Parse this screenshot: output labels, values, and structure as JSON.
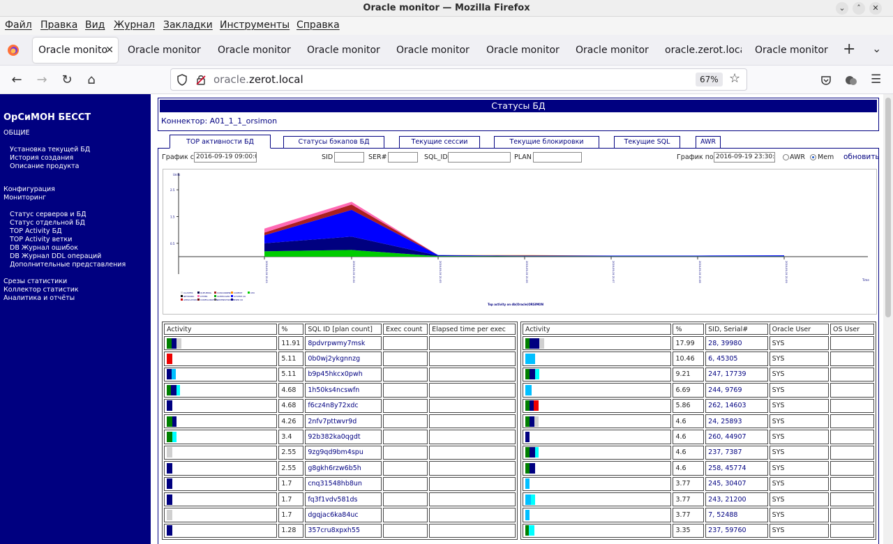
{
  "window": {
    "title": "Oracle monitor — Mozilla Firefox"
  },
  "menu": [
    "Файл",
    "Правка",
    "Вид",
    "Журнал",
    "Закладки",
    "Инструменты",
    "Справка"
  ],
  "tabs": [
    {
      "label": "Oracle monito",
      "active": true
    },
    {
      "label": "Oracle monitor"
    },
    {
      "label": "Oracle monitor"
    },
    {
      "label": "Oracle monitor"
    },
    {
      "label": "Oracle monitor"
    },
    {
      "label": "Oracle monitor"
    },
    {
      "label": "Oracle monitor"
    },
    {
      "label": "oracle.zerot.loca"
    },
    {
      "label": "Oracle monitor"
    }
  ],
  "urlbar": {
    "host_prefix": "oracle.",
    "host": "zerot.local",
    "zoom": "67%"
  },
  "sidebar": {
    "brand": "ОрСиМОН БЕССТ",
    "section_general": "ОБЩИЕ",
    "general_items": [
      "Установка текущей БД",
      "История создания",
      "Описание продукта"
    ],
    "config": "Конфигурация",
    "monitoring": "Мониторинг",
    "monitoring_items": [
      "Статус серверов и БД",
      "Статус отдельной БД",
      "TOP Activity БД",
      "TOP Activity ветки",
      "DB Журнал ошибок",
      "DB Журнал DDL операций",
      "Дополнительные представления"
    ],
    "bottom_items": [
      "Срезы статистики",
      "Коллектор статистик",
      "Аналитика и отчёты"
    ]
  },
  "page": {
    "status_title": "Статусы БД",
    "connector": "Коннектор: A01_1_1_orsimon",
    "tabs": [
      "TOP активности БД",
      "Статусы бэкапов БД",
      "Текущие сессии",
      "Текущие блокировки",
      "Текущие SQL",
      "AWR"
    ],
    "filters": {
      "from_label": "График с",
      "from_value": "2016-09-19 09:00:0",
      "sid_label": "SID",
      "ser_label": "SER#",
      "sqlid_label": "SQL_ID",
      "plan_label": "PLAN",
      "to_label": "График по",
      "to_value": "2016-09-19 23:30:0",
      "awr_label": "AWR",
      "mem_label": "Mem",
      "refresh": "обновить"
    }
  },
  "chart_data": {
    "type": "area",
    "title": "Top activity on db(Oracle)ORSIMON",
    "ylabel": "Units",
    "xlabel": "Time",
    "ylim": [
      0,
      3
    ],
    "yticks": [
      0.5,
      1.5,
      2.5
    ],
    "x": [
      "2016-09-19 21:03",
      "2016-09-19 21:04",
      "2016-09-19 21:05",
      "2016-09-19 21:06",
      "2016-09-19 21:07",
      "2016-09-19 21:08",
      "2016-09-19 21:09"
    ],
    "series": [
      {
        "name": "CPU",
        "color": "#00cc00",
        "values": [
          0.2,
          0.25,
          0.02,
          0.01,
          0.01,
          0.01,
          0.01
        ]
      },
      {
        "name": "USER I/O",
        "color": "#000080",
        "values": [
          0.3,
          0.5,
          0.02,
          0.01,
          0.01,
          0.01,
          0.01
        ]
      },
      {
        "name": "SYSTEM I/O",
        "color": "#0000ff",
        "values": [
          0.3,
          1.0,
          0.02,
          0.02,
          0.02,
          0.02,
          0.03
        ]
      },
      {
        "name": "CONCURRENCY",
        "color": "#aa2020",
        "values": [
          0.1,
          0.2,
          0.0,
          0.0,
          0.0,
          0.0,
          0.0
        ]
      },
      {
        "name": "OTHER",
        "color": "#ff69b4",
        "values": [
          0.15,
          0.1,
          0.0,
          0.0,
          0.0,
          0.0,
          0.0
        ]
      },
      {
        "name": "COMMIT",
        "color": "#ff8c00",
        "values": [
          0.0,
          0.0,
          0.0,
          0.02,
          0.0,
          0.0,
          0.0
        ]
      }
    ],
    "legend": [
      "CLUSTER",
      "NETWORK",
      "APPLICATION",
      "QUEUEING",
      "OTHER",
      "CONFIGURATION",
      "CONCURRENCY",
      "SCHEDULER",
      "ADMINISTRATIVE",
      "COMMIT",
      "SYSTEM I/O",
      "USER I/O",
      "CPU"
    ]
  },
  "sql_table": {
    "headers": [
      "Activity",
      "%",
      "SQL ID [plan count]",
      "Exec count",
      "Elapsed time per exec"
    ],
    "rows": [
      {
        "pct": "11.91",
        "id": "8pdvrpwmy7msk",
        "bars": [
          [
            "#008000",
            7
          ],
          [
            "#000080",
            7
          ],
          [
            "#d0d0d0",
            7
          ]
        ]
      },
      {
        "pct": "5.11",
        "id": "0b0wj2ykgnnzg",
        "bars": [
          [
            "#ee0000",
            8
          ]
        ]
      },
      {
        "pct": "5.11",
        "id": "b9p45hkcx0pwh",
        "bars": [
          [
            "#000080",
            7
          ],
          [
            "#00bfff",
            6
          ]
        ]
      },
      {
        "pct": "4.68",
        "id": "1h50ks4ncswfn",
        "bars": [
          [
            "#008000",
            6
          ],
          [
            "#000080",
            8
          ],
          [
            "#00ffff",
            5
          ]
        ]
      },
      {
        "pct": "4.68",
        "id": "f6cz4n8y72xdc",
        "bars": [
          [
            "#000080",
            8
          ]
        ]
      },
      {
        "pct": "4.26",
        "id": "2nfv7pttwvr9d",
        "bars": [
          [
            "#008000",
            8
          ],
          [
            "#000080",
            6
          ]
        ]
      },
      {
        "pct": "3.4",
        "id": "92b382ka0qgdt",
        "bars": [
          [
            "#008000",
            8
          ],
          [
            "#00ffff",
            6
          ]
        ]
      },
      {
        "pct": "2.55",
        "id": "9zg9qd9bm4spu",
        "bars": [
          [
            "#d0d0d0",
            8
          ]
        ]
      },
      {
        "pct": "2.55",
        "id": "g8gkh6rzw6b5h",
        "bars": [
          [
            "#000080",
            8
          ]
        ]
      },
      {
        "pct": "1.7",
        "id": "cnq31548hb8un",
        "bars": [
          [
            "#000080",
            8
          ]
        ]
      },
      {
        "pct": "1.7",
        "id": "fq3f1vdv581ds",
        "bars": [
          [
            "#000080",
            8
          ]
        ]
      },
      {
        "pct": "1.7",
        "id": "dgqjac6ka84uc",
        "bars": [
          [
            "#d0d0d0",
            8
          ]
        ]
      },
      {
        "pct": "1.28",
        "id": "357cru8xpxh55",
        "bars": [
          [
            "#000080",
            8
          ]
        ]
      }
    ]
  },
  "session_table": {
    "headers": [
      "Activity",
      "%",
      "SID, Serial#",
      "Oracle User",
      "OS User"
    ],
    "rows": [
      {
        "pct": "17.99",
        "sid": "28, 39980",
        "user": "SYS",
        "bars": [
          [
            "#008000",
            6
          ],
          [
            "#000080",
            14
          ],
          [
            "#d0d0d0",
            7
          ]
        ]
      },
      {
        "pct": "10.46",
        "sid": "6, 45305",
        "user": "SYS",
        "bars": [
          [
            "#00bfff",
            14
          ]
        ]
      },
      {
        "pct": "9.21",
        "sid": "247, 17739",
        "user": "SYS",
        "bars": [
          [
            "#008000",
            6
          ],
          [
            "#000080",
            8
          ],
          [
            "#00ffff",
            6
          ]
        ]
      },
      {
        "pct": "6.69",
        "sid": "244, 9769",
        "user": "SYS",
        "bars": [
          [
            "#00bfff",
            9
          ]
        ]
      },
      {
        "pct": "5.86",
        "sid": "262, 14603",
        "user": "SYS",
        "bars": [
          [
            "#008000",
            6
          ],
          [
            "#000080",
            6
          ],
          [
            "#ee0000",
            7
          ]
        ]
      },
      {
        "pct": "4.6",
        "sid": "24, 25893",
        "user": "SYS",
        "bars": [
          [
            "#008000",
            6
          ],
          [
            "#000080",
            7
          ],
          [
            "#d0d0d0",
            6
          ]
        ]
      },
      {
        "pct": "4.6",
        "sid": "260, 44907",
        "user": "SYS",
        "bars": [
          [
            "#000080",
            6
          ]
        ]
      },
      {
        "pct": "4.6",
        "sid": "237, 7387",
        "user": "SYS",
        "bars": [
          [
            "#008000",
            6
          ],
          [
            "#000080",
            8
          ],
          [
            "#00ffff",
            5
          ]
        ]
      },
      {
        "pct": "4.6",
        "sid": "258, 45774",
        "user": "SYS",
        "bars": [
          [
            "#008000",
            6
          ],
          [
            "#000080",
            8
          ]
        ]
      },
      {
        "pct": "3.77",
        "sid": "245, 30407",
        "user": "SYS",
        "bars": [
          [
            "#00bfff",
            6
          ]
        ]
      },
      {
        "pct": "3.77",
        "sid": "243, 21200",
        "user": "SYS",
        "bars": [
          [
            "#00bfff",
            8
          ],
          [
            "#00ffff",
            6
          ]
        ]
      },
      {
        "pct": "3.77",
        "sid": "7, 52488",
        "user": "SYS",
        "bars": [
          [
            "#00bfff",
            6
          ]
        ]
      },
      {
        "pct": "3.35",
        "sid": "237, 59760",
        "user": "SYS",
        "bars": [
          [
            "#008000",
            5
          ],
          [
            "#00ffff",
            8
          ]
        ]
      }
    ]
  }
}
